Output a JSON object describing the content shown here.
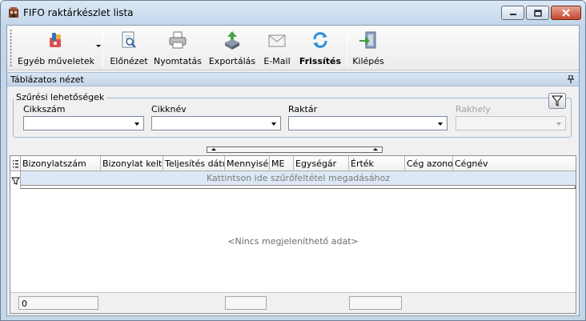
{
  "window": {
    "title": "FIFO raktárkészlet lista"
  },
  "toolbar": {
    "items": [
      {
        "label": "Egyéb műveletek",
        "icon": "tools-icon"
      },
      {
        "label": "Előnézet",
        "icon": "preview-icon"
      },
      {
        "label": "Nyomtatás",
        "icon": "printer-icon"
      },
      {
        "label": "Exportálás",
        "icon": "export-icon"
      },
      {
        "label": "E-Mail",
        "icon": "email-icon"
      },
      {
        "label": "Frissítés",
        "icon": "refresh-icon"
      },
      {
        "label": "Kilépés",
        "icon": "exit-icon"
      }
    ]
  },
  "panel": {
    "title": "Táblázatos nézet"
  },
  "filters": {
    "legend": "Szűrési lehetőségek",
    "fields": [
      {
        "label": "Cikkszám",
        "value": ""
      },
      {
        "label": "Cikknév",
        "value": ""
      },
      {
        "label": "Raktár",
        "value": ""
      },
      {
        "label": "Rakhely",
        "value": ""
      }
    ]
  },
  "grid": {
    "columns": [
      "Bizonylatszám",
      "Bizonylat kelte",
      "Teljesítés dátuma",
      "Mennyiség",
      "ME",
      "Egységár",
      "Érték",
      "Cég azonosító",
      "Cégnév"
    ],
    "filter_row_text": "Kattintson ide szűrőfeltétel megadásához",
    "empty_text": "<Nincs megjeleníthető adat>",
    "footer": {
      "count": "0"
    }
  },
  "colors": {
    "accent": "#c3d6ea",
    "close": "#c4452c",
    "filter_row": "#dce8f5"
  }
}
